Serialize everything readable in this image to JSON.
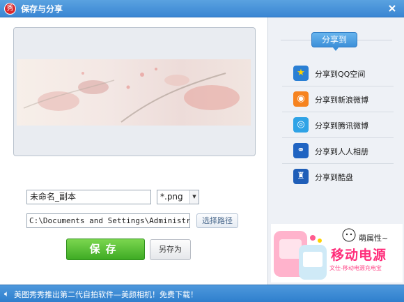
{
  "window": {
    "title": "保存与分享",
    "logo_char": "秀"
  },
  "main": {
    "filename": "未命名_副本",
    "format": "*.png",
    "path": "C:\\Documents and Settings\\Administrator",
    "browse_label": "选择路径",
    "save_label": "保存",
    "saveas_label": "另存为"
  },
  "side": {
    "header": "分享到",
    "items": [
      {
        "label": "分享到QQ空间",
        "icon": "qzone-star-icon",
        "color": "#2a7fd4",
        "glyph": "★"
      },
      {
        "label": "分享到新浪微博",
        "icon": "sina-weibo-icon",
        "color": "#f6831f",
        "glyph": "◉"
      },
      {
        "label": "分享到腾讯微博",
        "icon": "tencent-weibo-icon",
        "color": "#2fa3e6",
        "glyph": "◎"
      },
      {
        "label": "分享到人人相册",
        "icon": "renren-icon",
        "color": "#2064c2",
        "glyph": "⚭"
      },
      {
        "label": "分享到酷盘",
        "icon": "kupan-icon",
        "color": "#1f5eb8",
        "glyph": "♜"
      }
    ],
    "ad": {
      "title": "移动电源",
      "tag": "萌属性~",
      "subtitle": "文仕-移动电源充电宝"
    }
  },
  "status": {
    "text": "美图秀秀推出第二代自拍软件—美颜相机！免费下载！"
  },
  "colors": {
    "titlebar": "#3a86d3",
    "save_button": "#3eab24",
    "status_bar": "#2f7fcd"
  }
}
